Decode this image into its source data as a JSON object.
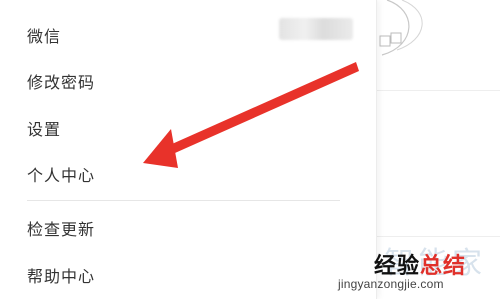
{
  "menu": {
    "items": [
      {
        "label": "微信"
      },
      {
        "label": "修改密码"
      },
      {
        "label": "设置"
      },
      {
        "label": "个人中心"
      },
      {
        "label": "检查更新"
      },
      {
        "label": "帮助中心"
      }
    ]
  },
  "annotation": {
    "arrow_color": "#e8322a"
  },
  "watermark": {
    "faint_text": "智能家",
    "title_part1": "经验",
    "title_part2": "总结",
    "subtitle": "jingyanzongjie.com",
    "accent_color": "#e0302a"
  }
}
